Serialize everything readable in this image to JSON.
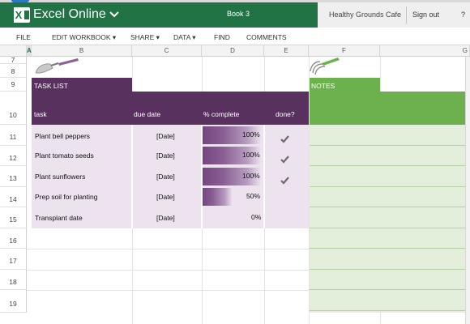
{
  "app": {
    "name": "Excel Online",
    "workbook": "Book 3",
    "account": "Healthy Grounds Cafe",
    "signout": "Sign out",
    "help": "?"
  },
  "menu": [
    {
      "label": "FILE"
    },
    {
      "label": "EDIT WORKBOOK ▾"
    },
    {
      "label": "SHARE ▾"
    },
    {
      "label": "DATA ▾"
    },
    {
      "label": "FIND"
    },
    {
      "label": "COMMENTS"
    }
  ],
  "columns": [
    "A",
    "B",
    "C",
    "D",
    "E",
    "F",
    "G"
  ],
  "rows": [
    "7",
    "8",
    "9",
    "10",
    "11",
    "12",
    "13",
    "14",
    "15",
    "16",
    "17",
    "18",
    "19"
  ],
  "task_list": {
    "title": "TASK LIST",
    "headers": {
      "task": "task",
      "due": "due date",
      "pct": "% complete",
      "done": "done?"
    },
    "items": [
      {
        "task": "Plant bell peppers",
        "due": "[Date]",
        "pct": "100%",
        "pct_value": 1.0,
        "done": true
      },
      {
        "task": "Plant tomato seeds",
        "due": "[Date]",
        "pct": "100%",
        "pct_value": 1.0,
        "done": true
      },
      {
        "task": "Plant sunflowers",
        "due": "[Date]",
        "pct": "100%",
        "pct_value": 1.0,
        "done": true
      },
      {
        "task": "Prep soil for planting",
        "due": "[Date]",
        "pct": "50%",
        "pct_value": 0.5,
        "done": false
      },
      {
        "task": "Transplant date",
        "due": "[Date]",
        "pct": "0%",
        "pct_value": 0.0,
        "done": false
      }
    ]
  },
  "notes": {
    "title": "NOTES"
  },
  "colors": {
    "excel_green": "#217346",
    "purple": "#59315f",
    "light_purple": "#ece3ef",
    "notes_green": "#6db14f",
    "light_green": "#e3efdb"
  }
}
